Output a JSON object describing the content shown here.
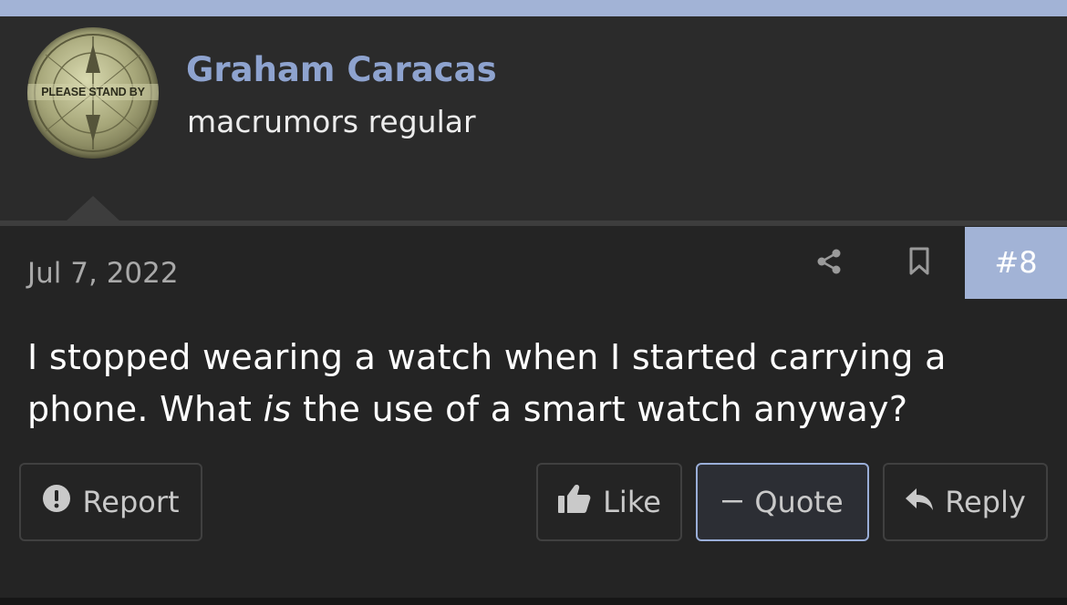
{
  "user": {
    "name": "Graham Caracas",
    "title": "macrumors regular",
    "avatar_text": "PLEASE STAND BY"
  },
  "post": {
    "date": "Jul 7, 2022",
    "number": "#8",
    "message_before": "I stopped wearing a watch when I started carrying a phone. What ",
    "message_emphasis": "is",
    "message_after": " the use of a smart watch anyway?"
  },
  "actions": {
    "report_label": "Report",
    "like_label": "Like",
    "quote_label": "Quote",
    "reply_label": "Reply"
  },
  "icons": {
    "share": "share-icon",
    "bookmark": "bookmark-icon",
    "report": "exclamation-circle-icon",
    "like": "thumbs-up-icon",
    "quote": "minus-icon",
    "reply": "reply-arrow-icon"
  },
  "colors": {
    "accent": "#a2b3d6",
    "username": "#8ea3cf",
    "header_bg": "#2b2b2b",
    "post_bg": "#242424"
  }
}
